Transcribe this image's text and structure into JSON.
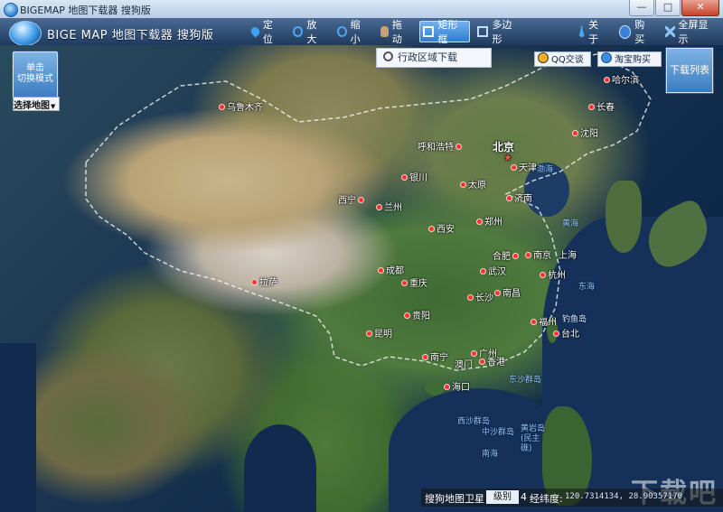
{
  "window": {
    "title": "BIGEMAP 地图下载器 搜狗版",
    "minimize": "—",
    "maximize": "□",
    "close": "✕"
  },
  "toolbar": {
    "logo_text": "BIGE MAP 地图下载器 搜狗版",
    "tools": [
      {
        "label": "定位",
        "icon": "pin-icon"
      },
      {
        "label": "放大",
        "icon": "zoom-in-icon"
      },
      {
        "label": "缩小",
        "icon": "zoom-out-icon"
      },
      {
        "label": "拖动",
        "icon": "hand-icon"
      },
      {
        "label": "矩形框",
        "icon": "rectangle-icon",
        "active": true
      },
      {
        "label": "多边形",
        "icon": "polygon-icon"
      }
    ],
    "about": "关于",
    "buy": "购买",
    "fullscreen": "全屏显示"
  },
  "map_controls": {
    "switch_mode_line1": "单击",
    "switch_mode_line2": "切换模式",
    "select_map": "选择地图",
    "admin_download": "行政区域下载",
    "qq_chat": "QQ交谈",
    "taobao_buy": "淘宝购买",
    "download_list": "下载列表"
  },
  "cities": [
    {
      "name": "乌鲁木齐"
    },
    {
      "name": "哈尔滨"
    },
    {
      "name": "长春"
    },
    {
      "name": "沈阳"
    },
    {
      "name": "呼和浩特"
    },
    {
      "name": "北京"
    },
    {
      "name": "天津"
    },
    {
      "name": "渤海"
    },
    {
      "name": "银川"
    },
    {
      "name": "太原"
    },
    {
      "name": "西宁"
    },
    {
      "name": "兰州"
    },
    {
      "name": "济南"
    },
    {
      "name": "黄海"
    },
    {
      "name": "郑州"
    },
    {
      "name": "西安"
    },
    {
      "name": "合肥"
    },
    {
      "name": "南京"
    },
    {
      "name": "上海"
    },
    {
      "name": "武汉"
    },
    {
      "name": "成都"
    },
    {
      "name": "杭州"
    },
    {
      "name": "拉萨"
    },
    {
      "name": "重庆"
    },
    {
      "name": "东海"
    },
    {
      "name": "长沙"
    },
    {
      "name": "南昌"
    },
    {
      "name": "贵阳"
    },
    {
      "name": "福州"
    },
    {
      "name": "钓鱼岛"
    },
    {
      "name": "台北"
    },
    {
      "name": "昆明"
    },
    {
      "name": "广州"
    },
    {
      "name": "南宁"
    },
    {
      "name": "澳门"
    },
    {
      "name": "香港"
    },
    {
      "name": "海口"
    },
    {
      "name": "东沙群岛"
    },
    {
      "name": "西沙群岛"
    },
    {
      "name": "中沙群岛"
    },
    {
      "name": "黄岩岛(民主礁)"
    },
    {
      "name": "南海"
    }
  ],
  "status": {
    "map_name": "搜狗地图",
    "type": "卫星",
    "level_label": "级别",
    "level_value": "4",
    "coord_label": "经纬度:",
    "coords": "120.7314134, 28.90357170"
  },
  "watermark": "下载吧"
}
